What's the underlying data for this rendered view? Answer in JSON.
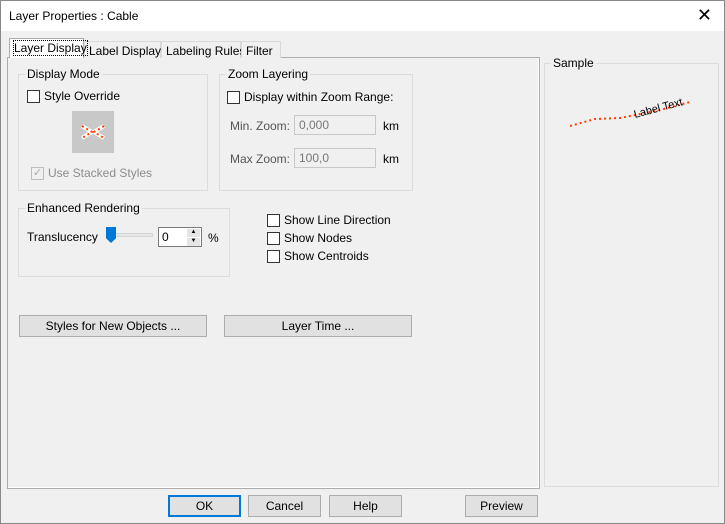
{
  "window": {
    "title": "Layer Properties  : Cable"
  },
  "tabs": [
    {
      "label": "Layer Display"
    },
    {
      "label": "Label Display"
    },
    {
      "label": "Labeling Rules"
    },
    {
      "label": "Filter"
    }
  ],
  "display_mode": {
    "title": "Display Mode",
    "style_override": "Style Override",
    "style_override_checked": false,
    "use_stacked_styles": "Use Stacked Styles",
    "use_stacked_checked": true,
    "style_color": "#ff3c00"
  },
  "zoom_layering": {
    "title": "Zoom Layering",
    "display_within": "Display within Zoom Range:",
    "min_label": "Min. Zoom:",
    "min_value": "0,000",
    "max_label": "Max Zoom:",
    "max_value": "100,0",
    "unit": "km"
  },
  "enhanced": {
    "title": "Enhanced Rendering",
    "translucency_label": "Translucency",
    "translucency_value": "0",
    "unit": "%",
    "slider_percent": 0
  },
  "options": [
    {
      "label": "Show Line Direction",
      "checked": false
    },
    {
      "label": "Show Nodes",
      "checked": false
    },
    {
      "label": "Show Centroids",
      "checked": false
    }
  ],
  "buttons": {
    "styles_new": "Styles for New Objects ...",
    "layer_time": "Layer Time ...",
    "ok": "OK",
    "cancel": "Cancel",
    "help": "Help",
    "preview": "Preview"
  },
  "sample": {
    "title": "Sample",
    "label_text": "Label Text"
  }
}
